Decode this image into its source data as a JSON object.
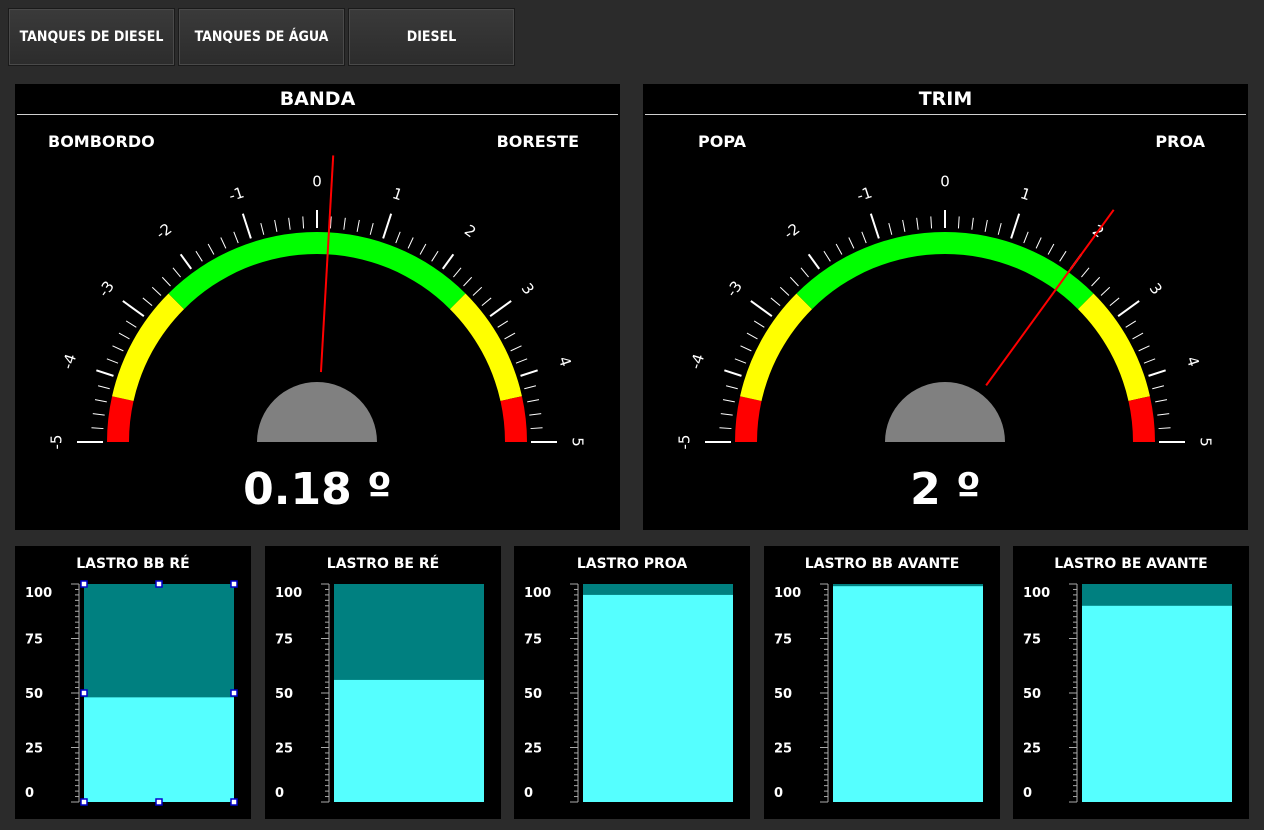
{
  "nav": {
    "tabs": [
      "TANQUES DE DIESEL",
      "TANQUES DE ÁGUA",
      "DIESEL"
    ]
  },
  "gauges": [
    {
      "title": "BANDA",
      "left_label": "BOMBORDO",
      "right_label": "BORESTE",
      "value": 0.18,
      "value_text": "0.18 º",
      "scale": [
        "-5",
        "-4",
        "-3",
        "-2",
        "-1",
        "0",
        "1",
        "2",
        "3",
        "4",
        "5"
      ]
    },
    {
      "title": "TRIM",
      "left_label": "POPA",
      "right_label": "PROA",
      "value": 2,
      "value_text": "2 º",
      "scale": [
        "-5",
        "-4",
        "-3",
        "-2",
        "-1",
        "0",
        "1",
        "2",
        "3",
        "4",
        "5"
      ]
    }
  ],
  "tanks": [
    {
      "title": "LASTRO BB RÉ",
      "level": 48
    },
    {
      "title": "LASTRO BE RÉ",
      "level": 56
    },
    {
      "title": "LASTRO PROA",
      "level": 95
    },
    {
      "title": "LASTRO BB AVANTE",
      "level": 99
    },
    {
      "title": "LASTRO BE AVANTE",
      "level": 90
    }
  ],
  "tank_scale": [
    "100",
    "75",
    "50",
    "25",
    "0"
  ],
  "colors": {
    "green_zone": "#00ff00",
    "yellow_zone": "#ffff00",
    "red_zone": "#ff0000",
    "needle": "#ff0000",
    "hub": "#808080",
    "tank_empty": "#008080",
    "tank_fill": "#55ffff",
    "selection_handle": "#0000cc"
  }
}
